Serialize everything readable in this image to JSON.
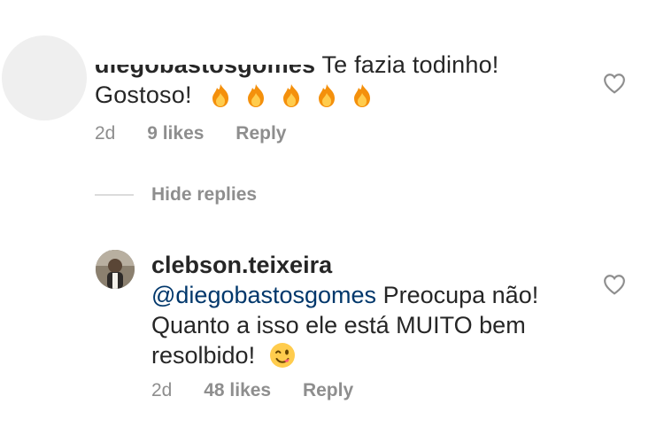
{
  "comment": {
    "username": "diegobastosgomes",
    "text_line1": "Te fazia todinho!",
    "text_line2": "Gostoso!",
    "emoji_icons": [
      "fire-icon",
      "fire-icon",
      "fire-icon",
      "fire-icon",
      "fire-icon"
    ],
    "time": "2d",
    "likes": "9 likes",
    "reply_label": "Reply"
  },
  "hide_replies": "Hide replies",
  "reply": {
    "username": "clebson.teixeira",
    "mention": "@diegobastosgomes",
    "text": "Preocupa não! Quanto a isso ele está MUITO bem resolbido!",
    "emoji_icon": "winking-face-icon",
    "time": "2d",
    "likes": "48 likes",
    "reply_label": "Reply"
  },
  "colors": {
    "text": "#262626",
    "muted": "#8e8e8e",
    "mention": "#00376b",
    "divider": "#dbdbdb"
  }
}
